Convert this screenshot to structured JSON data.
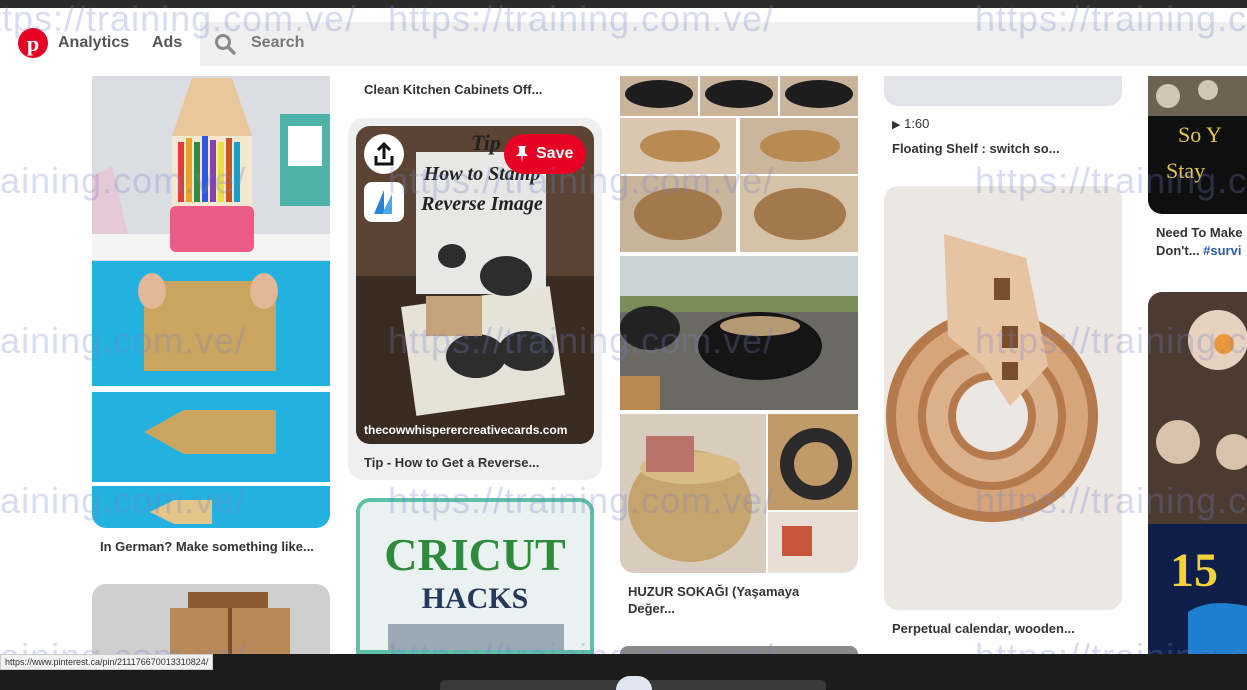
{
  "header": {
    "brand_color": "#e60023",
    "logo_icon": "pinterest-logo",
    "nav": [
      "Analytics",
      "Ads"
    ],
    "search": {
      "icon": "search-icon",
      "placeholder": "Search"
    }
  },
  "pins": {
    "col1": {
      "caption": "In German? Make something like..."
    },
    "col2": {
      "top_caption": "Clean Kitchen Cabinets Off...",
      "hover_pin": {
        "save_label": "Save",
        "image_title_line1": "Tip",
        "image_title_line2": "How to Stamp",
        "image_title_line3": "Reverse Image",
        "source_link": "thecowwhisperercreativecards.com",
        "caption": "Tip - How to Get a Reverse..."
      },
      "cricut_line1": "CRICUT",
      "cricut_line2": "HACKS"
    },
    "col3": {
      "caption": "HUZUR SOKAĞI (Yaşamaya Değer..."
    },
    "col4": {
      "video_duration": "1:60",
      "caption_top": "Floating Shelf : switch so...",
      "caption": "Perpetual calendar, wooden..."
    },
    "col5": {
      "image_text_line1": "So Y",
      "image_text_line2": "Stay",
      "caption": "Need To Make",
      "caption_line2": "Don't...",
      "hashtag": "#survi",
      "big_number": "15"
    }
  },
  "status_url": "https://www.pinterest.ca/pin/211176670013310824/",
  "watermark": "https://training.com.ve/"
}
